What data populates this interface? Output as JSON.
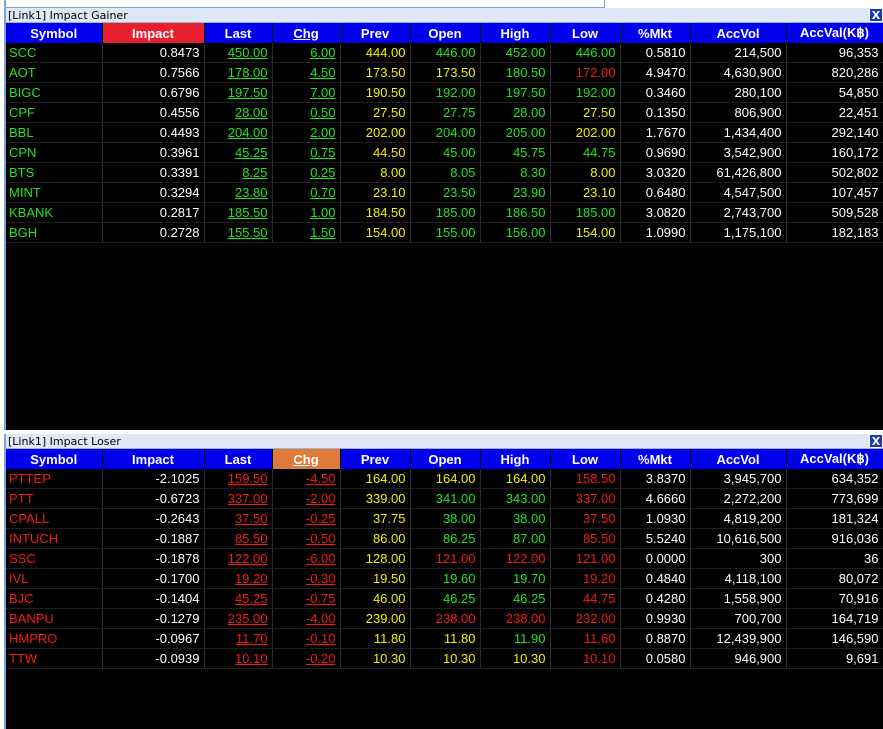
{
  "gainer": {
    "title": "[Link1] Impact Gainer",
    "close": "X",
    "columns": [
      "Symbol",
      "Impact",
      "Last",
      "Chg",
      "Prev",
      "Open",
      "High",
      "Low",
      "%Mkt",
      "AccVol",
      "AccVal(K฿)"
    ],
    "rows": [
      {
        "symbol": "SCC",
        "impact": "0.8473",
        "last": "450.00",
        "chg": "6.00",
        "prev": "444.00",
        "open": "446.00",
        "high": "452.00",
        "low": "446.00",
        "mkt": "0.5810",
        "accvol": "214,500",
        "accval": "96,353",
        "c": [
          "g",
          "w",
          "g",
          "g",
          "y",
          "g",
          "g",
          "g",
          "w",
          "w",
          "w"
        ]
      },
      {
        "symbol": "AOT",
        "impact": "0.7566",
        "last": "178.00",
        "chg": "4.50",
        "prev": "173.50",
        "open": "173.50",
        "high": "180.50",
        "low": "172.00",
        "mkt": "4.9470",
        "accvol": "4,630,900",
        "accval": "820,286",
        "c": [
          "g",
          "w",
          "g",
          "g",
          "y",
          "y",
          "g",
          "r",
          "w",
          "w",
          "w"
        ]
      },
      {
        "symbol": "BIGC",
        "impact": "0.6796",
        "last": "197.50",
        "chg": "7.00",
        "prev": "190.50",
        "open": "192.00",
        "high": "197.50",
        "low": "192.00",
        "mkt": "0.3460",
        "accvol": "280,100",
        "accval": "54,850",
        "c": [
          "g",
          "w",
          "g",
          "g",
          "y",
          "g",
          "g",
          "g",
          "w",
          "w",
          "w"
        ]
      },
      {
        "symbol": "CPF",
        "impact": "0.4556",
        "last": "28.00",
        "chg": "0.50",
        "prev": "27.50",
        "open": "27.75",
        "high": "28.00",
        "low": "27.50",
        "mkt": "0.1350",
        "accvol": "806,900",
        "accval": "22,451",
        "c": [
          "g",
          "w",
          "g",
          "g",
          "y",
          "g",
          "g",
          "y",
          "w",
          "w",
          "w"
        ]
      },
      {
        "symbol": "BBL",
        "impact": "0.4493",
        "last": "204.00",
        "chg": "2.00",
        "prev": "202.00",
        "open": "204.00",
        "high": "205.00",
        "low": "202.00",
        "mkt": "1.7670",
        "accvol": "1,434,400",
        "accval": "292,140",
        "c": [
          "g",
          "w",
          "g",
          "g",
          "y",
          "g",
          "g",
          "y",
          "w",
          "w",
          "w"
        ]
      },
      {
        "symbol": "CPN",
        "impact": "0.3961",
        "last": "45.25",
        "chg": "0.75",
        "prev": "44.50",
        "open": "45.00",
        "high": "45.75",
        "low": "44.75",
        "mkt": "0.9690",
        "accvol": "3,542,900",
        "accval": "160,172",
        "c": [
          "g",
          "w",
          "g",
          "g",
          "y",
          "g",
          "g",
          "g",
          "w",
          "w",
          "w"
        ]
      },
      {
        "symbol": "BTS",
        "impact": "0.3391",
        "last": "8.25",
        "chg": "0.25",
        "prev": "8.00",
        "open": "8.05",
        "high": "8.30",
        "low": "8.00",
        "mkt": "3.0320",
        "accvol": "61,426,800",
        "accval": "502,802",
        "c": [
          "g",
          "w",
          "g",
          "g",
          "y",
          "g",
          "g",
          "y",
          "w",
          "w",
          "w"
        ]
      },
      {
        "symbol": "MINT",
        "impact": "0.3294",
        "last": "23.80",
        "chg": "0.70",
        "prev": "23.10",
        "open": "23.50",
        "high": "23.90",
        "low": "23.10",
        "mkt": "0.6480",
        "accvol": "4,547,500",
        "accval": "107,457",
        "c": [
          "g",
          "w",
          "g",
          "g",
          "y",
          "g",
          "g",
          "y",
          "w",
          "w",
          "w"
        ]
      },
      {
        "symbol": "KBANK",
        "impact": "0.2817",
        "last": "185.50",
        "chg": "1.00",
        "prev": "184.50",
        "open": "185.00",
        "high": "186.50",
        "low": "185.00",
        "mkt": "3.0820",
        "accvol": "2,743,700",
        "accval": "509,528",
        "c": [
          "g",
          "w",
          "g",
          "g",
          "y",
          "g",
          "g",
          "g",
          "w",
          "w",
          "w"
        ]
      },
      {
        "symbol": "BGH",
        "impact": "0.2728",
        "last": "155.50",
        "chg": "1.50",
        "prev": "154.00",
        "open": "155.00",
        "high": "156.00",
        "low": "154.00",
        "mkt": "1.0990",
        "accvol": "1,175,100",
        "accval": "182,183",
        "c": [
          "g",
          "w",
          "g",
          "g",
          "y",
          "g",
          "g",
          "y",
          "w",
          "w",
          "w"
        ]
      }
    ]
  },
  "loser": {
    "title": "[Link1] Impact Loser",
    "close": "X",
    "columns": [
      "Symbol",
      "Impact",
      "Last",
      "Chg",
      "Prev",
      "Open",
      "High",
      "Low",
      "%Mkt",
      "AccVol",
      "AccVal(K฿)"
    ],
    "rows": [
      {
        "symbol": "PTTEP",
        "impact": "-2.1025",
        "last": "159.50",
        "chg": "-4.50",
        "prev": "164.00",
        "open": "164.00",
        "high": "164.00",
        "low": "158.50",
        "mkt": "3.8370",
        "accvol": "3,945,700",
        "accval": "634,352",
        "c": [
          "r",
          "w",
          "r",
          "r",
          "y",
          "y",
          "y",
          "r",
          "w",
          "w",
          "w"
        ]
      },
      {
        "symbol": "PTT",
        "impact": "-0.6723",
        "last": "337.00",
        "chg": "-2.00",
        "prev": "339.00",
        "open": "341.00",
        "high": "343.00",
        "low": "337.00",
        "mkt": "4.6660",
        "accvol": "2,272,200",
        "accval": "773,699",
        "c": [
          "r",
          "w",
          "r",
          "r",
          "y",
          "g",
          "g",
          "r",
          "w",
          "w",
          "w"
        ]
      },
      {
        "symbol": "CPALL",
        "impact": "-0.2643",
        "last": "37.50",
        "chg": "-0.25",
        "prev": "37.75",
        "open": "38.00",
        "high": "38.00",
        "low": "37.50",
        "mkt": "1.0930",
        "accvol": "4,819,200",
        "accval": "181,324",
        "c": [
          "r",
          "w",
          "r",
          "r",
          "y",
          "g",
          "g",
          "r",
          "w",
          "w",
          "w"
        ]
      },
      {
        "symbol": "INTUCH",
        "impact": "-0.1887",
        "last": "85.50",
        "chg": "-0.50",
        "prev": "86.00",
        "open": "86.25",
        "high": "87.00",
        "low": "85.50",
        "mkt": "5.5240",
        "accvol": "10,616,500",
        "accval": "916,036",
        "c": [
          "r",
          "w",
          "r",
          "r",
          "y",
          "g",
          "g",
          "r",
          "w",
          "w",
          "w"
        ]
      },
      {
        "symbol": "SSC",
        "impact": "-0.1878",
        "last": "122.00",
        "chg": "-6.00",
        "prev": "128.00",
        "open": "121.00",
        "high": "122.00",
        "low": "121.00",
        "mkt": "0.0000",
        "accvol": "300",
        "accval": "36",
        "c": [
          "r",
          "w",
          "r",
          "r",
          "y",
          "r",
          "r",
          "r",
          "w",
          "w",
          "w"
        ]
      },
      {
        "symbol": "IVL",
        "impact": "-0.1700",
        "last": "19.20",
        "chg": "-0.30",
        "prev": "19.50",
        "open": "19.60",
        "high": "19.70",
        "low": "19.20",
        "mkt": "0.4840",
        "accvol": "4,118,100",
        "accval": "80,072",
        "c": [
          "r",
          "w",
          "r",
          "r",
          "y",
          "g",
          "g",
          "r",
          "w",
          "w",
          "w"
        ]
      },
      {
        "symbol": "BJC",
        "impact": "-0.1404",
        "last": "45.25",
        "chg": "-0.75",
        "prev": "46.00",
        "open": "46.25",
        "high": "46.25",
        "low": "44.75",
        "mkt": "0.4280",
        "accvol": "1,558,900",
        "accval": "70,916",
        "c": [
          "r",
          "w",
          "r",
          "r",
          "y",
          "g",
          "g",
          "r",
          "w",
          "w",
          "w"
        ]
      },
      {
        "symbol": "BANPU",
        "impact": "-0.1279",
        "last": "235.00",
        "chg": "-4.00",
        "prev": "239.00",
        "open": "238.00",
        "high": "238.00",
        "low": "232.00",
        "mkt": "0.9930",
        "accvol": "700,700",
        "accval": "164,719",
        "c": [
          "r",
          "w",
          "r",
          "r",
          "y",
          "r",
          "r",
          "r",
          "w",
          "w",
          "w"
        ]
      },
      {
        "symbol": "HMPRO",
        "impact": "-0.0967",
        "last": "11.70",
        "chg": "-0.10",
        "prev": "11.80",
        "open": "11.80",
        "high": "11.90",
        "low": "11.60",
        "mkt": "0.8870",
        "accvol": "12,439,900",
        "accval": "146,590",
        "c": [
          "r",
          "w",
          "r",
          "r",
          "y",
          "y",
          "g",
          "r",
          "w",
          "w",
          "w"
        ]
      },
      {
        "symbol": "TTW",
        "impact": "-0.0939",
        "last": "10.10",
        "chg": "-0.20",
        "prev": "10.30",
        "open": "10.30",
        "high": "10.30",
        "low": "10.10",
        "mkt": "0.0580",
        "accvol": "946,900",
        "accval": "9,691",
        "c": [
          "r",
          "w",
          "r",
          "r",
          "y",
          "y",
          "y",
          "r",
          "w",
          "w",
          "w"
        ]
      }
    ]
  }
}
